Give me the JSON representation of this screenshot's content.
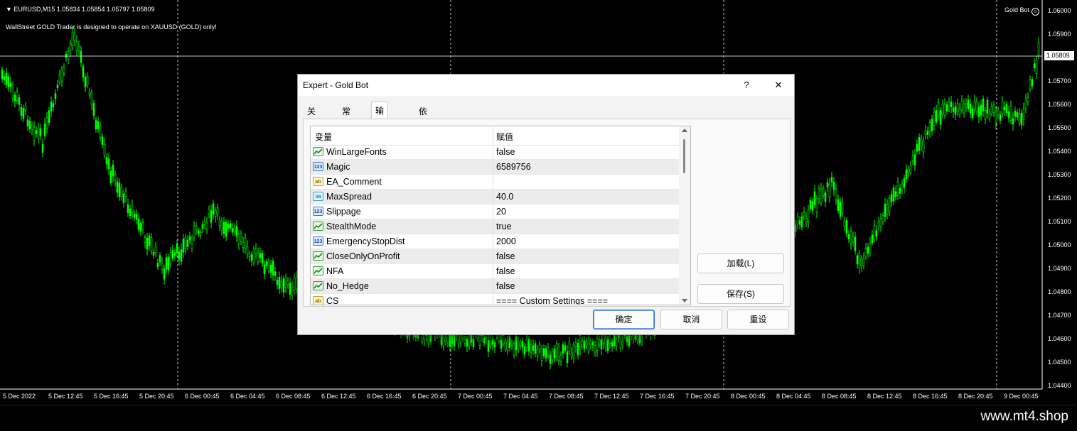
{
  "chart": {
    "header": "▼  EURUSD,M15  1.05834 1.05854 1.05797 1.05809",
    "message": "WallStreet GOLD Trader is designed to operate on XAUUSD (GOLD) only!",
    "ea_name": "Gold Bot",
    "ea_icon": "smiley-icon",
    "current_price": "1.05809",
    "price_labels": [
      "1.06000",
      "1.05900",
      "1.05800",
      "1.05700",
      "1.05600",
      "1.05500",
      "1.05400",
      "1.05300",
      "1.05200",
      "1.05100",
      "1.05000",
      "1.04900",
      "1.04800",
      "1.04700",
      "1.04600",
      "1.04500",
      "1.04400"
    ],
    "time_labels": [
      "5 Dec 2022",
      "5 Dec 12:45",
      "5 Dec 16:45",
      "5 Dec 20:45",
      "6 Dec 00:45",
      "6 Dec 04:45",
      "6 Dec 08:45",
      "6 Dec 12:45",
      "6 Dec 16:45",
      "6 Dec 20:45",
      "7 Dec 00:45",
      "7 Dec 04:45",
      "7 Dec 08:45",
      "7 Dec 12:45",
      "7 Dec 16:45",
      "7 Dec 20:45",
      "8 Dec 00:45",
      "8 Dec 04:45",
      "8 Dec 08:45",
      "8 Dec 12:45",
      "8 Dec 16:45",
      "8 Dec 20:45",
      "9 Dec 00:45"
    ],
    "candle_color": "#00ff00"
  },
  "dialog": {
    "title": "Expert - Gold Bot",
    "help": "?",
    "close": "✕",
    "tabs": [
      "关于",
      "常用",
      "输入参数",
      "依存关系"
    ],
    "active_tab": "输入参数",
    "columns": [
      "变量",
      "赋值"
    ],
    "rows": [
      {
        "icon": "bool",
        "badge": "",
        "name": "WinLargeFonts",
        "value": "false"
      },
      {
        "icon": "int",
        "badge": "123",
        "name": "Magic",
        "value": "6589756"
      },
      {
        "icon": "str",
        "badge": "ab",
        "name": "EA_Comment",
        "value": ""
      },
      {
        "icon": "dbl",
        "badge": "Va",
        "name": "MaxSpread",
        "value": "40.0"
      },
      {
        "icon": "int",
        "badge": "123",
        "name": "Slippage",
        "value": "20"
      },
      {
        "icon": "bool",
        "badge": "",
        "name": "StealthMode",
        "value": "true"
      },
      {
        "icon": "int",
        "badge": "123",
        "name": "EmergencyStopDist",
        "value": "2000"
      },
      {
        "icon": "bool",
        "badge": "",
        "name": "CloseOnlyOnProfit",
        "value": "false"
      },
      {
        "icon": "bool",
        "badge": "",
        "name": "NFA",
        "value": "false"
      },
      {
        "icon": "bool",
        "badge": "",
        "name": "No_Hedge",
        "value": "false"
      },
      {
        "icon": "str",
        "badge": "ab",
        "name": "CS",
        "value": "==== Custom Settings ===="
      }
    ],
    "buttons": {
      "load": "加载(L)",
      "save": "保存(S)",
      "ok": "确定",
      "cancel": "取消",
      "reset": "重设"
    }
  },
  "watermark": "www.mt4.shop"
}
